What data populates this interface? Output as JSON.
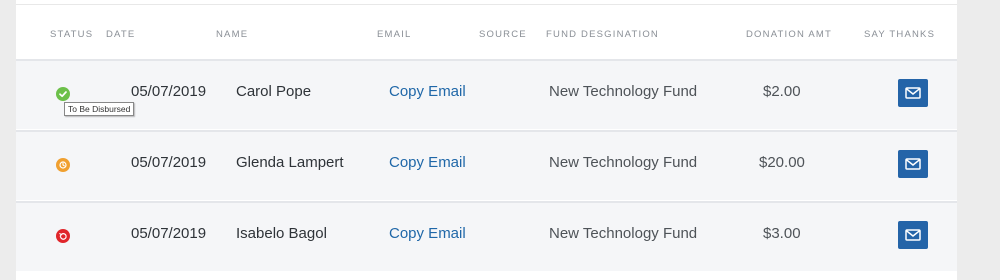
{
  "table": {
    "headers": {
      "status": "STATUS",
      "date": "DATE",
      "name": "NAME",
      "email": "EMAIL",
      "source": "SOURCE",
      "fund": "FUND DESGINATION",
      "amount": "DONATION AMT",
      "thanks": "SAY THANKS"
    },
    "rows": [
      {
        "status": "to-be-disbursed",
        "status_color": "#6cc04a",
        "status_tooltip": "To Be Disbursed",
        "date": "05/07/2019",
        "name": "Carol Pope",
        "email_link": "Copy Email",
        "source": "",
        "fund": "New Technology Fund",
        "amount": "$2.00",
        "thanks_icon": "mail-icon"
      },
      {
        "status": "pending",
        "status_color": "#f0a030",
        "date": "05/07/2019",
        "name": "Glenda Lampert",
        "email_link": "Copy Email",
        "source": "",
        "fund": "New Technology Fund",
        "amount": "$20.00",
        "thanks_icon": "mail-icon"
      },
      {
        "status": "failed",
        "status_color": "#e0262b",
        "date": "05/07/2019",
        "name": "Isabelo Bagol",
        "email_link": "Copy Email",
        "source": "",
        "fund": "New Technology Fund",
        "amount": "$3.00",
        "thanks_icon": "mail-icon"
      }
    ]
  },
  "colors": {
    "accent": "#2464a8",
    "link": "#1f67a8",
    "row_bg": "#f5f6f8"
  }
}
